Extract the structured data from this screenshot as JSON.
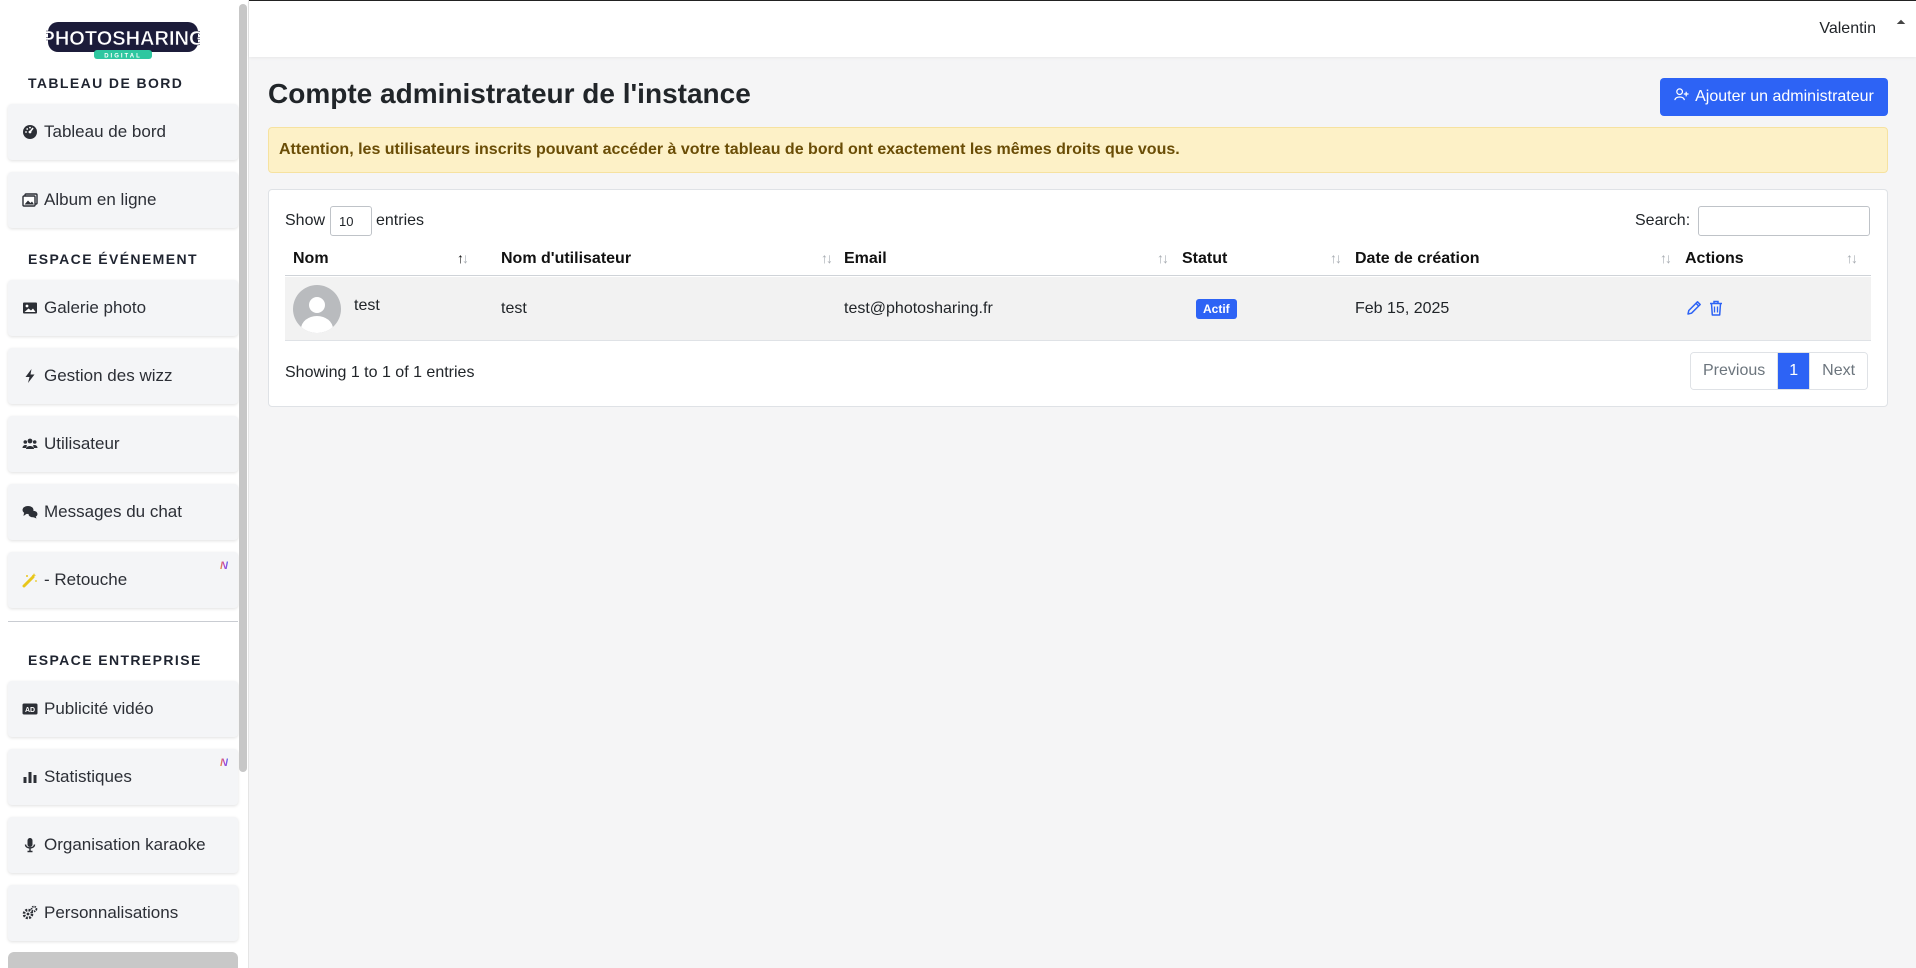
{
  "app": {
    "logo_text": "PHOTOSHARING",
    "logo_sub": "DIGITAL"
  },
  "sidebar": {
    "section_dashboard": "TABLEAU DE BORD",
    "section_event": "ESPACE ÉVÉNEMENT",
    "section_company": "ESPACE ENTREPRISE",
    "items": [
      {
        "label": "Tableau de bord",
        "icon": "dashboard-gauge-icon"
      },
      {
        "label": "Album en ligne",
        "icon": "images-icon"
      },
      {
        "label": "Galerie photo",
        "icon": "image-icon"
      },
      {
        "label": "Gestion des wizz",
        "icon": "bolt-icon"
      },
      {
        "label": "Utilisateur",
        "icon": "users-icon"
      },
      {
        "label": "Messages du chat",
        "icon": "comments-icon"
      },
      {
        "label": "- Retouche",
        "icon": "magic-wand-icon",
        "badge": "N"
      },
      {
        "label": "Publicité vidéo",
        "icon": "ad-icon"
      },
      {
        "label": "Statistiques",
        "icon": "bar-chart-icon",
        "badge": "N"
      },
      {
        "label": "Organisation karaoke",
        "icon": "microphone-icon"
      },
      {
        "label": "Personnalisations",
        "icon": "gears-icon"
      }
    ]
  },
  "topbar": {
    "user_name": "Valentin"
  },
  "page": {
    "title_bold": "Compte",
    "title_rest": " administrateur de l'instance",
    "add_button_label": "Ajouter un administrateur",
    "alert_text": "Attention, les utilisateurs inscrits pouvant accéder à votre tableau de bord ont exactement les mêmes droits que vous."
  },
  "table": {
    "show_label": "Show",
    "page_length": "10",
    "entries_label": "entries",
    "search_label": "Search:",
    "search_value": "",
    "columns": [
      "Nom",
      "Nom d'utilisateur",
      "Email",
      "Statut",
      "Date de création",
      "Actions"
    ],
    "sorted_column": "Nom",
    "rows": [
      {
        "nom": "test",
        "username": "test",
        "email": "test@photosharing.fr",
        "statut": "Actif",
        "date": "Feb 15, 2025"
      }
    ],
    "info": "Showing 1 to 1 of 1 entries",
    "pagination": {
      "previous": "Previous",
      "current_page": "1",
      "next": "Next"
    }
  },
  "colors": {
    "primary": "#2d63f5",
    "alert_bg": "#fdf1c7",
    "alert_text": "#6a4d06"
  }
}
